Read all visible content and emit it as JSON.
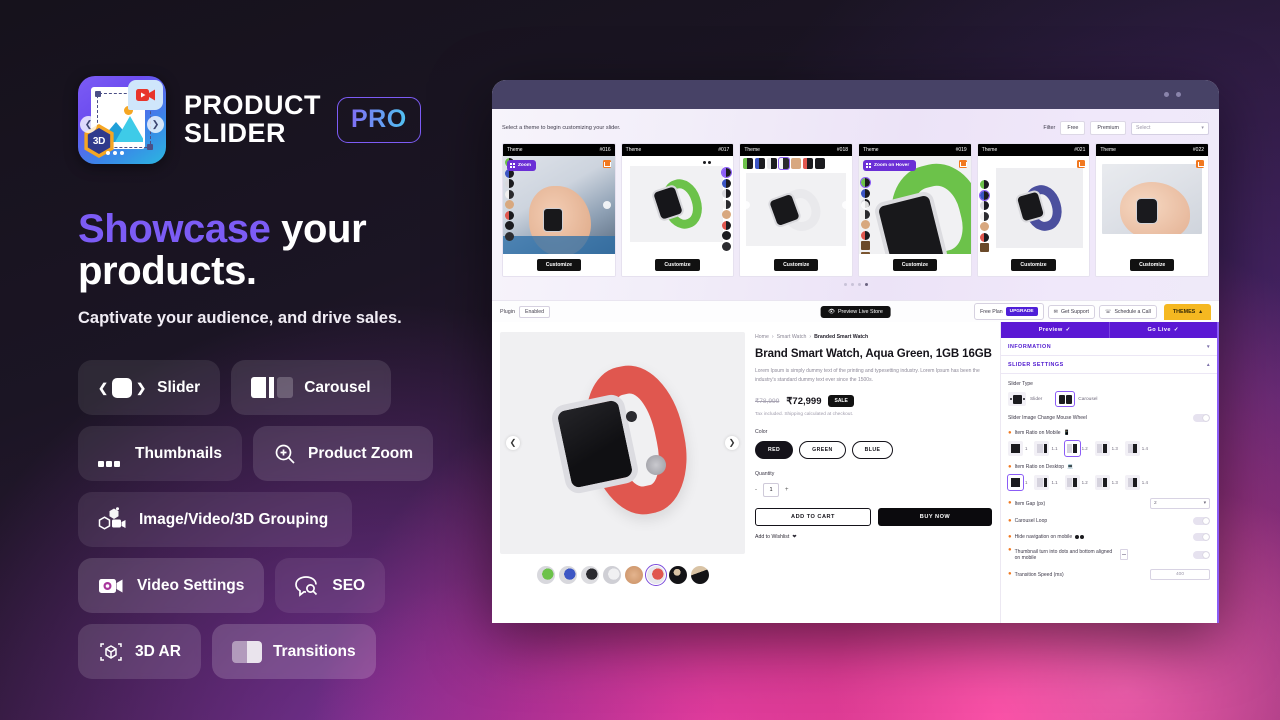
{
  "brand": {
    "title_line1": "PRODUCT",
    "title_line2": "SLIDER",
    "pro_badge": "PRO",
    "logo_3d_label": "3D"
  },
  "hero": {
    "headline_accent": "Showcase",
    "headline_rest": " your products.",
    "subhead": "Captivate your audience, and drive sales."
  },
  "features": [
    {
      "label": "Slider",
      "icon": "slider-icon"
    },
    {
      "label": "Carousel",
      "icon": "carousel-icon"
    },
    {
      "label": "Thumbnails",
      "icon": "thumbnails-icon"
    },
    {
      "label": "Product Zoom",
      "icon": "magnify-plus-icon"
    },
    {
      "label": "Image/Video/3D Grouping",
      "icon": "cube-video-icon"
    },
    {
      "label": "Video Settings",
      "icon": "video-gear-icon"
    },
    {
      "label": "SEO",
      "icon": "seo-search-icon"
    },
    {
      "label": "3D AR",
      "icon": "cube-scan-icon"
    },
    {
      "label": "Transitions",
      "icon": "transitions-icon"
    }
  ],
  "gallery": {
    "hint": "Select a theme to begin customizing your slider.",
    "filter_label": "Filter",
    "filter_free": "Free",
    "filter_premium": "Premium",
    "select_placeholder": "Select",
    "customize_label": "Customize",
    "theme_label": "Theme",
    "zoom_chip": "Zoom",
    "zoom_hover_chip": "Zoom on Hover",
    "cards": [
      {
        "id": "#016",
        "badge": "zoom",
        "premium": true
      },
      {
        "id": "#017",
        "badge": "none",
        "premium": false
      },
      {
        "id": "#018",
        "badge": "none",
        "premium": false
      },
      {
        "id": "#019",
        "badge": "zoom-hover",
        "premium": true
      },
      {
        "id": "#021",
        "badge": "none",
        "premium": true
      },
      {
        "id": "#022",
        "badge": "none",
        "premium": true
      }
    ],
    "pager_count": 4,
    "pager_active": 3
  },
  "toolbar": {
    "plugin_label": "Plugin",
    "plugin_state": "Enabled",
    "preview_live_store": "Preview Live Store",
    "free_plan": "Free Plan",
    "upgrade": "UPGRADE",
    "get_support": "Get Support",
    "schedule_call": "Schedule a Call",
    "themes_tab": "THEMES"
  },
  "product": {
    "breadcrumbs": [
      "Home",
      "Smart Watch",
      "Branded Smart Watch"
    ],
    "title": "Brand Smart Watch, Aqua Green, 1GB 16GB",
    "description": "Lorem Ipsum is simply dummy text of the printing and typesetting industry. Lorem Ipsum has been the industry's standard dummy text ever since the 1500s.",
    "price_old": "₹78,999",
    "price_new": "₹72,999",
    "sale_tag": "SALE",
    "tax_note": "Tax included. Shipping calculated at checkout.",
    "color_label": "Color",
    "colors": [
      "RED",
      "GREEN",
      "BLUE"
    ],
    "color_selected": "RED",
    "quantity_label": "Quantity",
    "quantity_value": "1",
    "qty_minus": "-",
    "qty_plus": "+",
    "add_to_cart": "ADD TO CART",
    "buy_now": "BUY NOW",
    "wishlist": "Add to Wishlist",
    "thumb_count": 8,
    "thumb_selected": 5
  },
  "settings": {
    "tab_preview": "Preview",
    "tab_go_live": "Go Live",
    "section_information": "INFORMATION",
    "section_slider_settings": "SLIDER SETTINGS",
    "slider_type_label": "Slider Type",
    "slider_type_options": [
      "Slider",
      "Carousel"
    ],
    "slider_type_selected": "Carousel",
    "mouse_wheel_label": "Slider Image Change Mouse Wheel",
    "mouse_wheel_on": false,
    "ratio_mobile_label": "Item Ratio on Mobile",
    "ratio_mobile_options": [
      "1",
      "1.1",
      "1.2",
      "1.3",
      "1.4"
    ],
    "ratio_mobile_selected": "1.2",
    "ratio_desktop_label": "Item Ratio on Desktop",
    "ratio_desktop_options": [
      "1",
      "1.1",
      "1.2",
      "1.3",
      "1.4"
    ],
    "ratio_desktop_selected": "1",
    "item_gap_label": "Item Gap (px)",
    "item_gap_value": "2",
    "carousel_loop_label": "Carousel Loop",
    "carousel_loop_on": false,
    "hide_nav_label": "Hide navigation on mobile",
    "hide_nav_on": false,
    "thumb_dots_label": "Thumbnail turn into dots and bottom aligned on mobile",
    "thumb_dots_on": false,
    "transition_speed_label": "Transition Speed (ms)",
    "transition_speed_value": "400"
  },
  "colors": {
    "accent_purple": "#7c5cf5",
    "deep_purple": "#5b18d4",
    "themes_yellow": "#f5b821",
    "premium_orange": "#f1781f",
    "watch_red": "#e0574f",
    "bg_dark": "#16121c"
  }
}
